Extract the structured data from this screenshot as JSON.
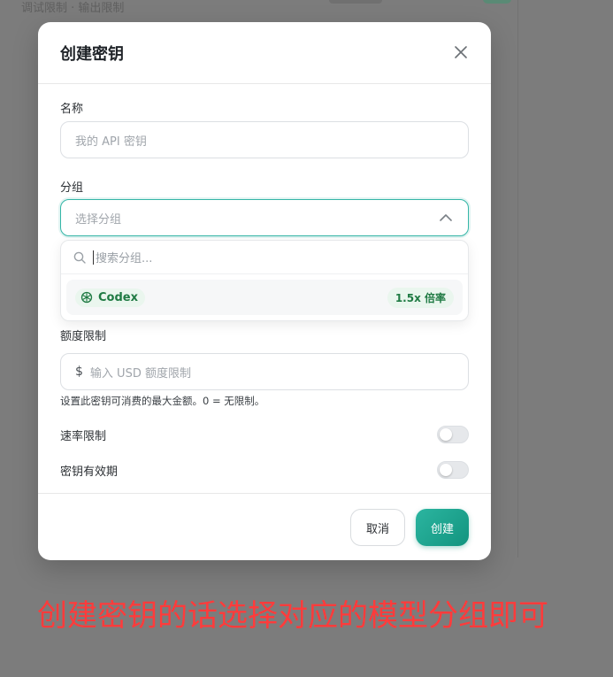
{
  "background": {
    "partial_text": "调试限制 · 输出限制"
  },
  "modal": {
    "title": "创建密钥",
    "name_label": "名称",
    "name_placeholder": "我的 API 密钥",
    "group_label": "分组",
    "group_placeholder": "选择分组",
    "dropdown": {
      "search_placeholder": "搜索分组...",
      "options": [
        {
          "name": "Codex",
          "rate": "1.5x 倍率"
        }
      ]
    },
    "quota_label": "额度限制",
    "quota_prefix": "$",
    "quota_placeholder": "输入 USD 额度限制",
    "quota_hint": "设置此密钥可消费的最大金额。0 = 无限制。",
    "rate_limit_label": "速率限制",
    "expiry_label": "密钥有效期",
    "cancel_label": "取消",
    "create_label": "创建"
  },
  "annotation": "创建密钥的话选择对应的模型分组即可",
  "colors": {
    "accent": "#1fa38f",
    "annotation": "#ff3b3b",
    "badge_text": "#1f7a43"
  }
}
